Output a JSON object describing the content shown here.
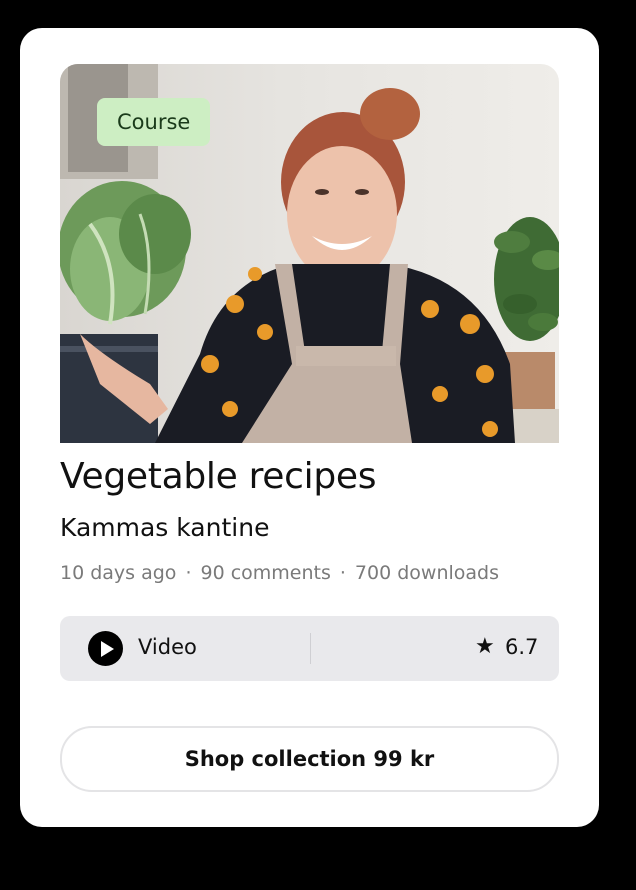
{
  "badge": {
    "label": "Course"
  },
  "course": {
    "title": "Vegetable recipes",
    "author": "Kammas kantine"
  },
  "meta": {
    "posted": "10 days ago",
    "comments": "90 comments",
    "downloads": "700 downloads",
    "separator": "·"
  },
  "infobar": {
    "type_icon": "play-icon",
    "type_label": "Video",
    "rating_icon": "star-icon",
    "rating": "6.7"
  },
  "shop": {
    "label": "Shop collection 99 kr"
  },
  "colors": {
    "badge_bg": "#cdeec3",
    "infobar_bg": "#e9e9ec",
    "meta_text": "#7a7a7a"
  }
}
